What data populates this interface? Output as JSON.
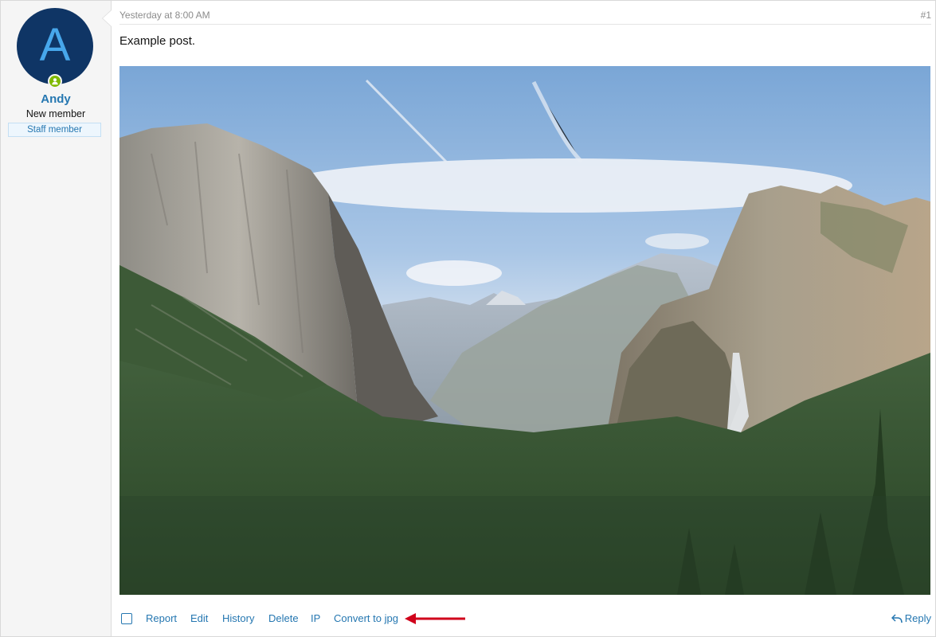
{
  "user": {
    "avatar_letter": "A",
    "name": "Andy",
    "title": "New member",
    "banner": "Staff member",
    "avatar_bg": "#0f3565",
    "avatar_letter_color": "#47a7eb",
    "online_color": "#7fb900"
  },
  "post": {
    "date": "Yesterday at 8:00 AM",
    "number": "#1",
    "text": "Example post.",
    "image_icon": "yosemite-valley-photo"
  },
  "actions": {
    "report": "Report",
    "edit": "Edit",
    "history": "History",
    "delete": "Delete",
    "ip": "IP",
    "convert": "Convert to jpg",
    "reply": "Reply"
  },
  "colors": {
    "link": "#2577b1",
    "annotation_arrow": "#d0021b"
  }
}
